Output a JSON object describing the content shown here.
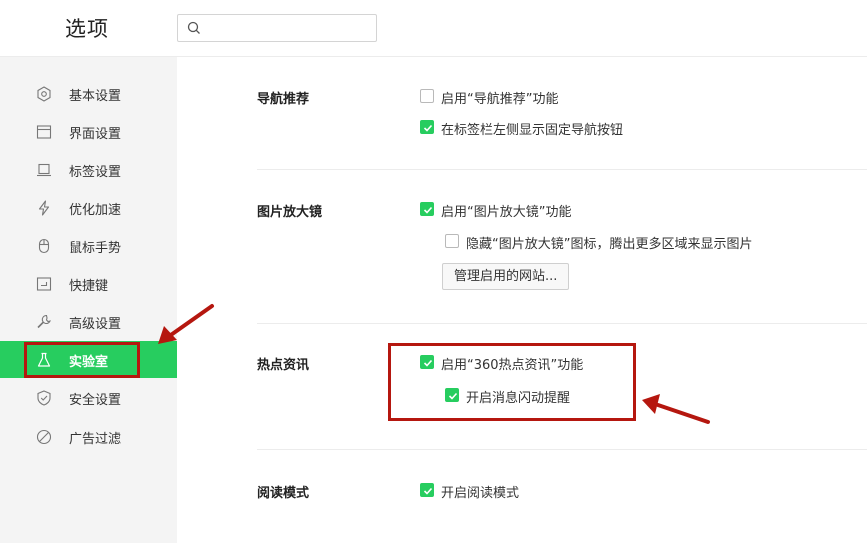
{
  "header": {
    "title": "选项",
    "search": {
      "placeholder": ""
    }
  },
  "sidebar": {
    "items": [
      {
        "label": "基本设置",
        "icon": "gear-icon",
        "active": false
      },
      {
        "label": "界面设置",
        "icon": "window-icon",
        "active": false
      },
      {
        "label": "标签设置",
        "icon": "tab-icon",
        "active": false
      },
      {
        "label": "优化加速",
        "icon": "lightning-icon",
        "active": false
      },
      {
        "label": "鼠标手势",
        "icon": "mouse-icon",
        "active": false
      },
      {
        "label": "快捷键",
        "icon": "keyboard-shortcut-icon",
        "active": false
      },
      {
        "label": "高级设置",
        "icon": "wrench-icon",
        "active": false
      },
      {
        "label": "实验室",
        "icon": "flask-icon",
        "active": true
      },
      {
        "label": "安全设置",
        "icon": "shield-icon",
        "active": false
      },
      {
        "label": "广告过滤",
        "icon": "block-icon",
        "active": false
      }
    ]
  },
  "sections": {
    "nav_recommend": {
      "title": "导航推荐",
      "options": [
        {
          "label": "启用“导航推荐”功能",
          "checked": false
        },
        {
          "label": "在标签栏左侧显示固定导航按钮",
          "checked": true
        }
      ]
    },
    "image_zoom": {
      "title": "图片放大镜",
      "options": [
        {
          "label": "启用“图片放大镜”功能",
          "checked": true
        },
        {
          "label": "隐藏“图片放大镜”图标，腾出更多区域来显示图片",
          "checked": false
        }
      ],
      "manage_button": "管理启用的网站..."
    },
    "hot_news": {
      "title": "热点资讯",
      "options": [
        {
          "label": "启用“360热点资讯”功能",
          "checked": true
        },
        {
          "label": "开启消息闪动提醒",
          "checked": true
        }
      ]
    },
    "reading_mode": {
      "title": "阅读模式",
      "options": [
        {
          "label": "开启阅读模式",
          "checked": true
        }
      ]
    }
  },
  "colors": {
    "accent": "#27cd5f",
    "annotation": "#b5170f",
    "sidebar_bg": "#f4f4f4"
  }
}
